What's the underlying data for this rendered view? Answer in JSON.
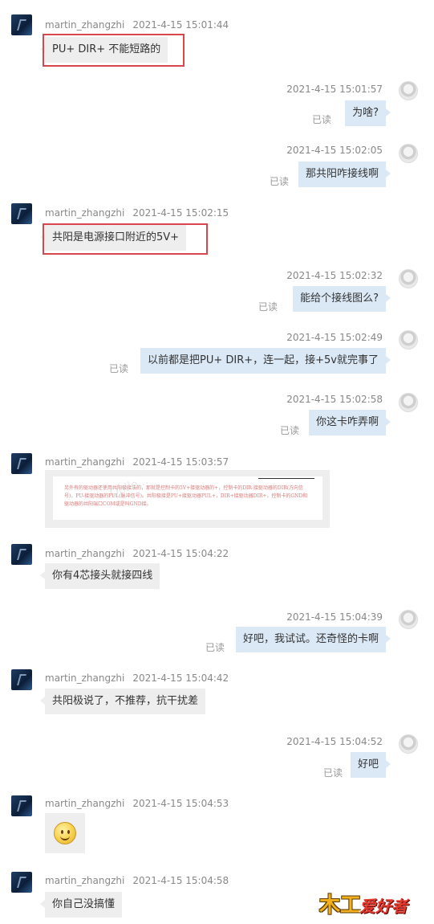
{
  "users": {
    "left": "martin_zhangzhi"
  },
  "read_label": "已读",
  "messages": [
    {
      "time": "2021-4-15 15:01:44",
      "text": "PU+ DIR+ 不能短路的"
    },
    {
      "time": "2021-4-15 15:01:57",
      "text": "为啥?"
    },
    {
      "time": "2021-4-15 15:02:05",
      "text": "那共阳咋接线啊"
    },
    {
      "time": "2021-4-15 15:02:15",
      "text": "共阳是电源接口附近的5V+"
    },
    {
      "time": "2021-4-15 15:02:32",
      "text": "能给个接线图么?"
    },
    {
      "time": "2021-4-15 15:02:49",
      "text": "以前都是把PU+ DIR+，连一起，接+5v就完事了"
    },
    {
      "time": "2021-4-15 15:02:58",
      "text": "你这卡咋弄啊"
    },
    {
      "time": "2021-4-15 15:03:57",
      "image_text": "另外有的驱动器还使用共阳极接法的，那就是控制卡的5V+接驱动器的+，控制卡的DIR-接驱动器的DIR(方向信号)，PU-接驱动器的PUL(脉冲信号)。共阳极接是PU+接驱动器PUL+，DIR+接驱动器DIR+，控制卡的GND和驱动器的共阳端口COM或是叫GND接。",
      "image_watermark": "Ohlle..."
    },
    {
      "time": "2021-4-15 15:04:22",
      "text": "你有4芯接头就接四线"
    },
    {
      "time": "2021-4-15 15:04:39",
      "text": "好吧，我试试。还奇怪的卡啊"
    },
    {
      "time": "2021-4-15 15:04:42",
      "text": "共阳极说了，不推荐，抗干扰差"
    },
    {
      "time": "2021-4-15 15:04:52",
      "text": "好吧"
    },
    {
      "time": "2021-4-15 15:04:53",
      "emoji": "smiley-face"
    },
    {
      "time": "2021-4-15 15:04:58",
      "text": "你自己没搞懂"
    }
  ],
  "watermark_logo": {
    "part1": "木工",
    "part2": "爱好者"
  },
  "colors": {
    "left_bubble": "#eeeeee",
    "right_bubble": "#dbe9f7",
    "highlight": "#d9464e"
  }
}
